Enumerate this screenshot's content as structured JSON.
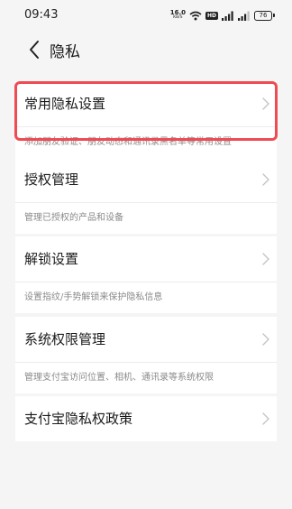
{
  "status_bar": {
    "time": "09:43",
    "net_speed_value": "16.0",
    "net_speed_unit": "KB/S",
    "hd_label": "HD",
    "battery": "76"
  },
  "header": {
    "title": "隐私"
  },
  "items": [
    {
      "title": "常用隐私设置",
      "desc": "添加朋友验证、朋友动态和通讯录黑名单等常用设置"
    },
    {
      "title": "授权管理",
      "desc": "管理已授权的产品和设备"
    },
    {
      "title": "解锁设置",
      "desc": "设置指纹/手势解锁来保护隐私信息"
    },
    {
      "title": "系统权限管理",
      "desc": "管理支付宝访问位置、相机、通讯录等系统权限"
    },
    {
      "title": "支付宝隐私权政策"
    }
  ],
  "colors": {
    "background": "#f5f5f5",
    "card": "#ffffff",
    "highlight": "#ee4b52",
    "secondary_text": "#8a8a8a"
  },
  "icons": [
    "back-arrow-icon",
    "chevron-right-icon",
    "wifi-icon",
    "signal-icon",
    "battery-icon"
  ]
}
